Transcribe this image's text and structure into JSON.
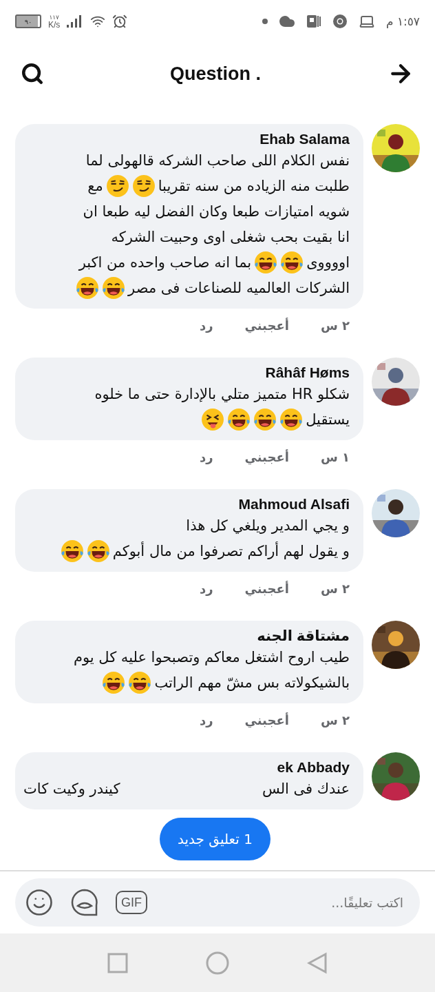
{
  "status_bar": {
    "battery": "٩٠",
    "speed": "١١٧",
    "speed_unit": "K/s",
    "time": "١:٥٧ م"
  },
  "header": {
    "title": "Question ."
  },
  "comments": [
    {
      "author": "Ehab Salama",
      "avatar": {
        "kind": "picture"
      },
      "lines": [
        {
          "kind": "normal",
          "parts": [
            {
              "kind": "text",
              "text": "نفس الكلام اللى صاحب الشركه قالهولى لما"
            }
          ]
        },
        {
          "kind": "normal",
          "parts": [
            {
              "kind": "text",
              "text": "طلبت منه الزياده من سنه تقريبا"
            },
            {
              "kind": "smirk"
            },
            {
              "kind": "smirk"
            },
            {
              "kind": "text",
              "text": "مع"
            }
          ]
        },
        {
          "kind": "normal",
          "parts": [
            {
              "kind": "text",
              "text": "شويه امتيازات  طبعا وكان الفضل ليه طبعا ان"
            }
          ]
        },
        {
          "kind": "normal",
          "parts": [
            {
              "kind": "text",
              "text": "انا بقيت بحب شغلى اوى وحبيت الشركه"
            }
          ]
        },
        {
          "kind": "normal",
          "parts": [
            {
              "kind": "text",
              "text": "اووووى"
            },
            {
              "kind": "laugh"
            },
            {
              "kind": "laugh"
            },
            {
              "kind": "text",
              "text": "بما انه صاحب واحده من اكبر"
            }
          ]
        },
        {
          "kind": "normal",
          "parts": [
            {
              "kind": "text",
              "text": "الشركات العالميه للصناعات فى مصر"
            },
            {
              "kind": "laugh"
            },
            {
              "kind": "laugh"
            }
          ]
        }
      ],
      "time": "٢ س",
      "like": "أعجبني",
      "reply": "رد"
    },
    {
      "author": "Râhâf Høms",
      "avatar": {
        "kind": "picture"
      },
      "lines": [
        {
          "kind": "normal",
          "parts": [
            {
              "kind": "text",
              "text": "شكلو HR متميز متلي بالإدارة  حتى ما خلوه"
            }
          ]
        },
        {
          "kind": "normal",
          "parts": [
            {
              "kind": "text",
              "text": "يستقيل"
            },
            {
              "kind": "laugh"
            },
            {
              "kind": "laugh"
            },
            {
              "kind": "laugh"
            },
            {
              "kind": "tongue"
            }
          ]
        }
      ],
      "time": "١ س",
      "like": "أعجبني",
      "reply": "رد"
    },
    {
      "author": "Mahmoud Alsafi",
      "avatar": {
        "kind": "picture"
      },
      "lines": [
        {
          "kind": "normal",
          "parts": [
            {
              "kind": "text",
              "text": "و يجي المدير ويلغي كل هذا"
            }
          ]
        },
        {
          "kind": "normal",
          "parts": [
            {
              "kind": "text",
              "text": "و يقول لهم أراكم تصرفوا من مال أبوكم"
            },
            {
              "kind": "laugh"
            },
            {
              "kind": "laugh"
            }
          ]
        }
      ],
      "time": "٢ س",
      "like": "أعجبني",
      "reply": "رد"
    },
    {
      "author": "مشتاقة الجنه",
      "avatar": {
        "kind": "picture"
      },
      "lines": [
        {
          "kind": "normal",
          "parts": [
            {
              "kind": "text",
              "text": "طيب اروح اشتغل معاكم وتصبحوا عليه كل يوم"
            }
          ]
        },
        {
          "kind": "normal",
          "parts": [
            {
              "kind": "text",
              "text": "بالشيكولاته بس مشّ مهم الراتب"
            },
            {
              "kind": "laugh"
            },
            {
              "kind": "laugh"
            }
          ]
        }
      ],
      "time": "٢ س",
      "like": "أعجبني",
      "reply": "رد"
    },
    {
      "author": "ek Abbady",
      "avatar": {
        "kind": "picture"
      },
      "lines": [
        {
          "kind": "split",
          "parts": [
            {
              "kind": "text",
              "text": "عندك فى الس"
            },
            {
              "kind": "text",
              "text": "كيندر وكيت كات"
            }
          ]
        }
      ]
    }
  ],
  "toast": {
    "label": "1 تعليق جديد"
  },
  "composer": {
    "placeholder": "اكتب تعليقًا...",
    "gif_label": "GIF"
  }
}
